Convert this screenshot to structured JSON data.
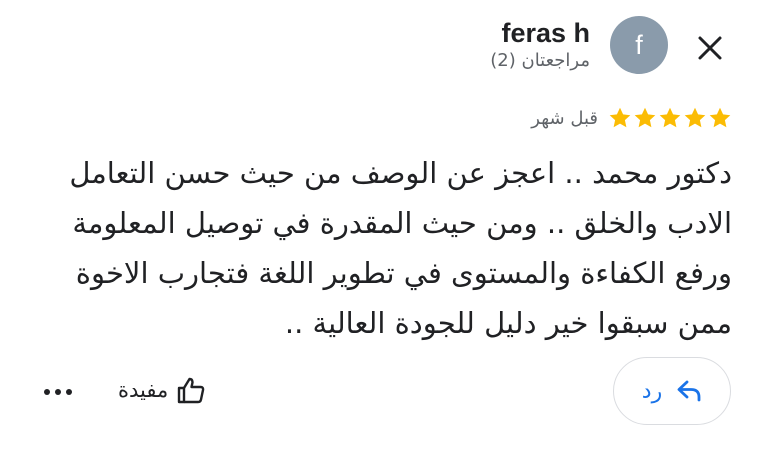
{
  "reviewer": {
    "name": "feras h",
    "avatar_letter": "f",
    "review_count": "مراجعتان (2)"
  },
  "rating": {
    "stars": 5,
    "max_stars": 5,
    "time_ago": "قبل شهر"
  },
  "review": {
    "text": "دكتور محمد .. اعجز عن الوصف من حيث حسن التعامل الادب والخلق .. ومن حيث المقدرة في توصيل المعلومة ورفع الكفاءة والمستوى في تطوير اللغة فتجارب الاخوة ممن سبقوا خير دليل للجودة العالية .."
  },
  "actions": {
    "reply_label": "رد",
    "helpful_label": "مفيدة"
  },
  "icons": {
    "close": "close-icon",
    "star": "star-icon",
    "reply": "reply-arrow-icon",
    "thumb_up": "thumb-up-icon",
    "more": "more-horizontal-icon"
  },
  "colors": {
    "star": "#FBBC04",
    "avatar_bg": "#8A9BAB",
    "accent": "#1A73E8",
    "secondary_text": "#5F6368"
  }
}
